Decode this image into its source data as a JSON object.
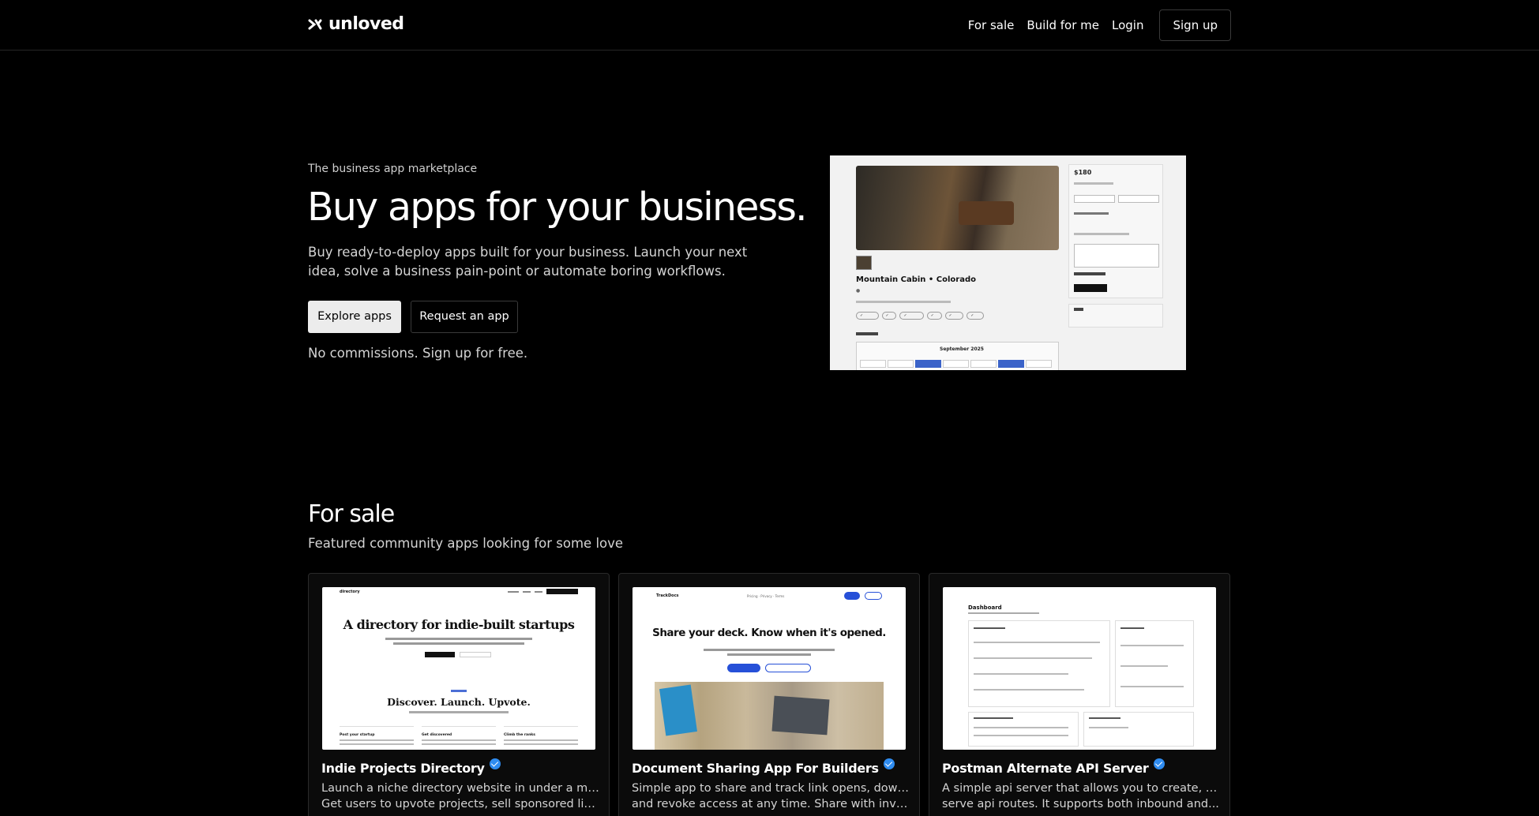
{
  "header": {
    "logo_text": "unloved",
    "nav": {
      "for_sale": "For sale",
      "build_for_me": "Build for me",
      "login": "Login",
      "sign_up": "Sign up"
    }
  },
  "hero": {
    "eyebrow": "The business app marketplace",
    "title": "Buy apps for your business.",
    "subtitle": "Buy ready-to-deploy apps built for your business. Launch your next idea, solve a business pain-point or automate boring workflows.",
    "primary_button": "Explore apps",
    "secondary_button": "Request an app",
    "note": "No commissions. Sign up for free.",
    "preview": {
      "listing_title": "Mountain Cabin • Colorado",
      "price": "$180",
      "calendar_month": "September 2025"
    }
  },
  "for_sale": {
    "title": "For sale",
    "subtitle": "Featured community apps looking for some love",
    "cards": [
      {
        "title": "Indie Projects Directory",
        "desc_line1": "Launch a niche directory website in under a minute.",
        "desc_line2": "Get users to upvote projects, sell sponsored listings...",
        "mock_headline": "A directory for indie-built startups",
        "mock_headline2": "Discover. Launch. Upvote.",
        "mock_logo": "directory",
        "mock_col1": "Post your startup",
        "mock_col2": "Get discovered",
        "mock_col3": "Climb the ranks"
      },
      {
        "title": "Document Sharing App For Builders",
        "desc_line1": "Simple app to share and track link opens, downloads",
        "desc_line2": "and revoke access at any time. Share with investors,...",
        "mock_headline": "Share your deck. Know when it's opened.",
        "mock_logo": "TrackDocs",
        "mock_links": "Pricing · Privacy · Terms"
      },
      {
        "title": "Postman Alternate API Server",
        "desc_line1": "A simple api server that allows you to create, test and",
        "desc_line2": "serve api routes. It supports both inbound and...",
        "mock_headline": "Dashboard"
      }
    ]
  },
  "colors": {
    "background": "#000000",
    "text": "#ffffff",
    "muted": "#d4d4d4",
    "verified": "#2f8cf0"
  }
}
